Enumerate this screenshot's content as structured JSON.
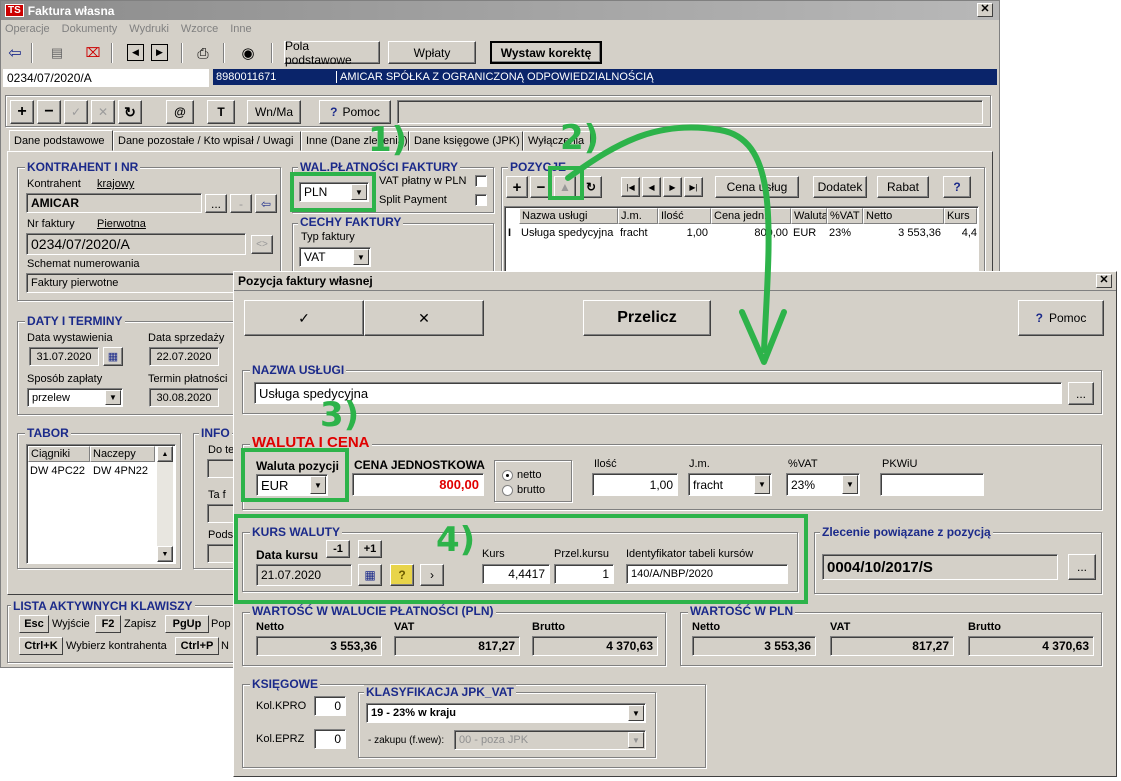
{
  "main_window": {
    "title": "Faktura własna",
    "app_icon": "TS",
    "menu": [
      "Operacje",
      "Dokumenty",
      "Wydruki",
      "Wzorce",
      "Inne"
    ],
    "toolbar": {
      "pola_podstawowe": "Pola podstawowe",
      "wplaty": "Wpłaty",
      "wystaw_korekte": "Wystaw korektę"
    },
    "header_bar": {
      "doc_number": "0234/07/2020/A",
      "nip": "8980011671",
      "company": "AMICAR SPÓŁKA Z OGRANICZONĄ ODPOWIEDZIALNOŚCIĄ"
    },
    "toolbar2": {
      "wn_ma": "Wn/Ma",
      "pomoc": "Pomoc",
      "t": "T",
      "at": "@"
    },
    "tabs": [
      "Dane podstawowe",
      "Dane pozostałe / Kto wpisał / Uwagi",
      "Inne (Dane zlecenia)",
      "Dane księgowe (JPK)",
      "Wyłączenia"
    ],
    "kontrahent": {
      "section": "KONTRAHENT I NR",
      "label": "Kontrahent",
      "type": "krajowy",
      "value": "AMICAR",
      "nr_label": "Nr faktury",
      "nr_type": "Pierwotna",
      "nr_value": "0234/07/2020/A",
      "schemat_label": "Schemat numerowania",
      "schemat_value": "Faktury pierwotne"
    },
    "waluta_platnosci": {
      "section": "WAL.PŁATNOŚCI FAKTURY",
      "currency": "PLN",
      "vat_pln": "VAT płatny w PLN",
      "split": "Split Payment"
    },
    "cechy": {
      "section": "CECHY FAKTURY",
      "typ_label": "Typ faktury",
      "typ_value": "VAT"
    },
    "pozycje": {
      "section": "POZYCJE",
      "cena_uslug": "Cena usług",
      "dodatek": "Dodatek",
      "rabat": "Rabat",
      "help": "?",
      "columns": [
        "Nazwa usługi",
        "J.m.",
        "Ilość",
        "Cena jedn.",
        "Waluta",
        "%VAT",
        "Netto",
        "Kurs"
      ],
      "rows": [
        [
          "Usługa spedycyjna",
          "fracht",
          "1,00",
          "800,00",
          "EUR",
          "23%",
          "3 553,36",
          "4,4"
        ]
      ]
    },
    "daty": {
      "section": "DATY I TERMINY",
      "wystawienia_label": "Data wystawienia",
      "wystawienia": "31.07.2020",
      "sprzedazy_label": "Data sprzedaży",
      "sprzedazy": "22.07.2020",
      "sposob_label": "Sposób zapłaty",
      "sposob": "przelew",
      "termin_label": "Termin płatności",
      "termin": "30.08.2020"
    },
    "tabor": {
      "section": "TABOR",
      "columns": [
        "Ciągniki",
        "Naczepy"
      ],
      "rows": [
        [
          "DW 4PC22",
          "DW 4PN22"
        ]
      ]
    },
    "info": {
      "section": "INFO",
      "do_te": "Do te",
      "ta_f": "Ta f",
      "pods": "Pods"
    },
    "klawisze": {
      "section": "LISTA AKTYWNYCH KLAWISZY",
      "items": [
        {
          "key": "Esc",
          "label": "Wyjście"
        },
        {
          "key": "F2",
          "label": "Zapisz"
        },
        {
          "key": "PgUp",
          "label": "Pop"
        },
        {
          "key": "Ctrl+K",
          "label": "Wybierz kontrahenta"
        },
        {
          "key": "Ctrl+P",
          "label": "N"
        }
      ]
    }
  },
  "dialog": {
    "title": "Pozycja faktury własnej",
    "ok": "✓",
    "cancel": "✕",
    "przelicz": "Przelicz",
    "pomoc": "Pomoc",
    "nazwa_section": "NAZWA USŁUGI",
    "nazwa_value": "Usługa spedycyjna",
    "waluta_section": "WALUTA I CENA",
    "waluta_pozycji_label": "Waluta pozycji",
    "waluta_pozycji": "EUR",
    "cena_label": "CENA JEDNOSTKOWA",
    "cena_value": "800,00",
    "netto": "netto",
    "brutto": "brutto",
    "ilosc_label": "Ilość",
    "ilosc": "1,00",
    "jm_label": "J.m.",
    "jm": "fracht",
    "vat_label": "%VAT",
    "vat": "23%",
    "pkwiu_label": "PKWiU",
    "pkwiu": "",
    "kurs_section": "KURS WALUTY",
    "data_kursu_label": "Data kursu",
    "minus1": "-1",
    "plus1": "+1",
    "data_kursu": "21.07.2020",
    "kurs_label": "Kurs",
    "kurs": "4,4417",
    "przel_label": "Przel.kursu",
    "przel": "1",
    "ident_label": "Identyfikator tabeli kursów",
    "ident": "140/A/NBP/2020",
    "zlecenie_label": "Zlecenie powiązane z pozycją",
    "zlecenie": "0004/10/2017/S",
    "wartosc_pln_platnosci": {
      "section": "WARTOŚĆ W WALUCIE PŁATNOŚCI (PLN)",
      "netto_label": "Netto",
      "netto": "3 553,36",
      "vat_label": "VAT",
      "vat": "817,27",
      "brutto_label": "Brutto",
      "brutto": "4 370,63"
    },
    "wartosc_pln": {
      "section": "WARTOŚĆ W PLN",
      "netto_label": "Netto",
      "netto": "3 553,36",
      "vat_label": "VAT",
      "vat": "817,27",
      "brutto_label": "Brutto",
      "brutto": "4 370,63"
    },
    "ksiegowe": {
      "section": "KSIĘGOWE",
      "kpro_label": "Kol.KPRO",
      "kpro": "0",
      "eprz_label": "Kol.EPRZ",
      "eprz": "0"
    },
    "jpk": {
      "section": "KLASYFIKACJA JPK_VAT",
      "value": "19 - 23% w kraju",
      "zakupu_label": "- zakupu (f.wew):",
      "zakupu": "00 - poza JPK"
    }
  },
  "annotations": [
    "1)",
    "2)",
    "3)",
    "4)"
  ],
  "colors": {
    "annotation_green": "#2db34a",
    "accent_red": "#e00000",
    "title_blue": "#0a246a"
  }
}
